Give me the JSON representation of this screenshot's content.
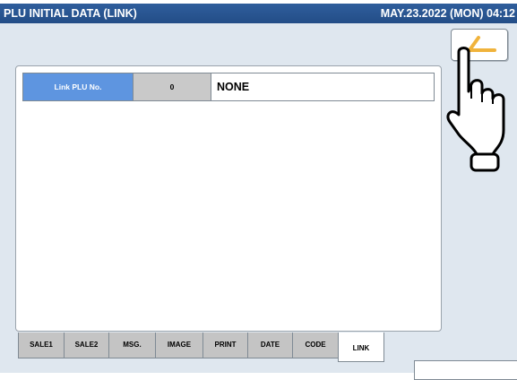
{
  "window": {
    "title": "PLU INITIAL DATA (LINK)",
    "datetime": "MAY.23.2022 (MON) 04:12"
  },
  "toolbar": {
    "back_icon": "back-arrow-icon"
  },
  "link_field": {
    "label": "Link PLU No.",
    "value": "0",
    "name": "NONE"
  },
  "tabs": [
    {
      "label": "SALE1",
      "active": false
    },
    {
      "label": "SALE2",
      "active": false
    },
    {
      "label": "MSG.",
      "active": false
    },
    {
      "label": "IMAGE",
      "active": false
    },
    {
      "label": "PRINT",
      "active": false
    },
    {
      "label": "DATE",
      "active": false
    },
    {
      "label": "CODE",
      "active": false
    },
    {
      "label": "LINK",
      "active": true
    }
  ],
  "colors": {
    "titlebar": "#2a5893",
    "label_bg": "#5e95e0",
    "screen_bg": "#dfe7ef",
    "arrow": "#f0b33c"
  },
  "pointer_icon": "pointing-hand-icon"
}
